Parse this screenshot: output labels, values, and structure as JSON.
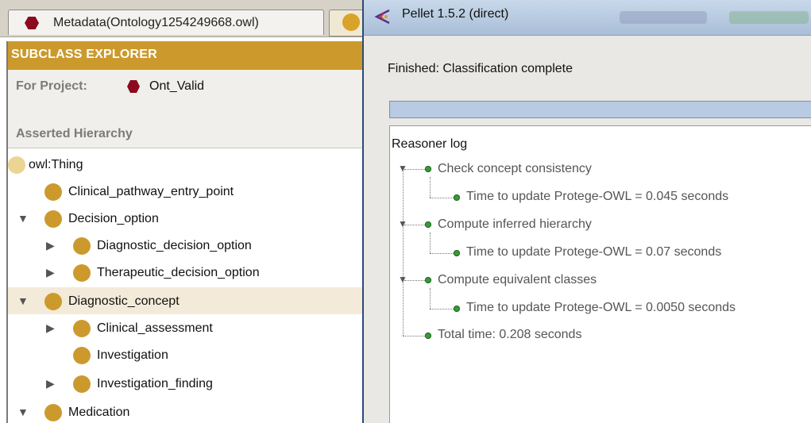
{
  "tabs": [
    {
      "label": "Metadata(Ontology1254249668.owl)"
    }
  ],
  "explorer": {
    "title": "SUBCLASS EXPLORER",
    "project_label": "For Project:",
    "project_name": "Ont_Valid",
    "hierarchy_title": "Asserted Hierarchy"
  },
  "tree": {
    "nodes": [
      {
        "label": "owl:Thing"
      },
      {
        "label": "Clinical_pathway_entry_point"
      },
      {
        "label": "Decision_option"
      },
      {
        "label": "Diagnostic_decision_option"
      },
      {
        "label": "Therapeutic_decision_option"
      },
      {
        "label": "Diagnostic_concept"
      },
      {
        "label": "Clinical_assessment"
      },
      {
        "label": "Investigation"
      },
      {
        "label": "Investigation_finding"
      },
      {
        "label": "Medication"
      }
    ]
  },
  "dialog": {
    "title": "Pellet 1.5.2 (direct)",
    "status": "Finished: Classification complete",
    "progress": 1.0,
    "log_title": "Reasoner log",
    "log": [
      {
        "text": "Check concept consistency"
      },
      {
        "text": "Time to update Protege-OWL = 0.045 seconds"
      },
      {
        "text": "Compute inferred hierarchy"
      },
      {
        "text": "Time to update Protege-OWL = 0.07 seconds"
      },
      {
        "text": "Compute equivalent classes"
      },
      {
        "text": "Time to update Protege-OWL = 0.0050 seconds"
      },
      {
        "text": "Total time: 0.208 seconds"
      }
    ]
  },
  "colors": {
    "accent": "#cc9a2c",
    "project_hex": "#8b0a1e",
    "log_dot": "#3a9a3a"
  },
  "icons": [
    "ontology-hex-icon",
    "class-dot-icon",
    "expand-arrow-icon",
    "collapse-arrow-icon",
    "pellet-icon",
    "status-dot-icon"
  ]
}
